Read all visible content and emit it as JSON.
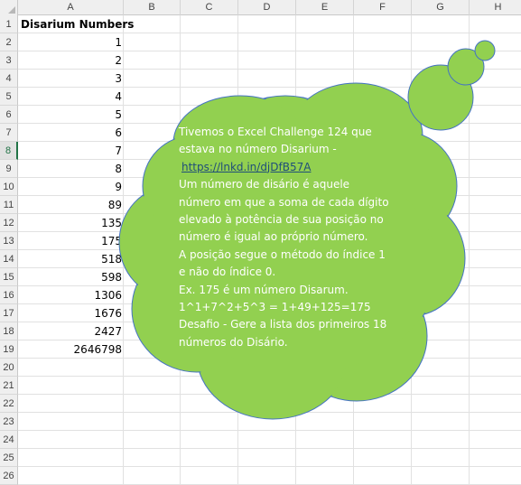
{
  "columns": [
    "A",
    "B",
    "C",
    "D",
    "E",
    "F",
    "G",
    "H"
  ],
  "rows": [
    "1",
    "2",
    "3",
    "4",
    "5",
    "6",
    "7",
    "8",
    "9",
    "10",
    "11",
    "12",
    "13",
    "14",
    "15",
    "16",
    "17",
    "18",
    "19",
    "20",
    "21",
    "22",
    "23",
    "24",
    "25",
    "26"
  ],
  "selected_row": "8",
  "column_a": {
    "header": "Disarium Numbers",
    "values": [
      "1",
      "2",
      "3",
      "4",
      "5",
      "6",
      "7",
      "8",
      "9",
      "89",
      "135",
      "175",
      "518",
      "598",
      "1306",
      "1676",
      "2427",
      "2646798"
    ]
  },
  "callout": {
    "fill_color": "#92d050",
    "stroke_color": "#4472c4",
    "text_color": "#ffffff",
    "link_color": "#1f4e79",
    "line1": "Tivemos o Excel Challenge 124 que",
    "line2": "estava no número Disarium -",
    "link": "https://lnkd.in/djDfB57A",
    "line4": "Um número de disário é aquele",
    "line5": "número em que a soma de cada dígito",
    "line6": "elevado à potência de sua posição no",
    "line7": "número é igual ao próprio número.",
    "line8": "A posição segue o método do índice 1",
    "line9": "e não do índice 0.",
    "line10": "Ex. 175 é um número Disarum.",
    "line11": "1^1+7^2+5^3 = 1+49+125=175",
    "line12": "Desafio - Gere a lista dos primeiros 18",
    "line13": "números do Disário."
  }
}
